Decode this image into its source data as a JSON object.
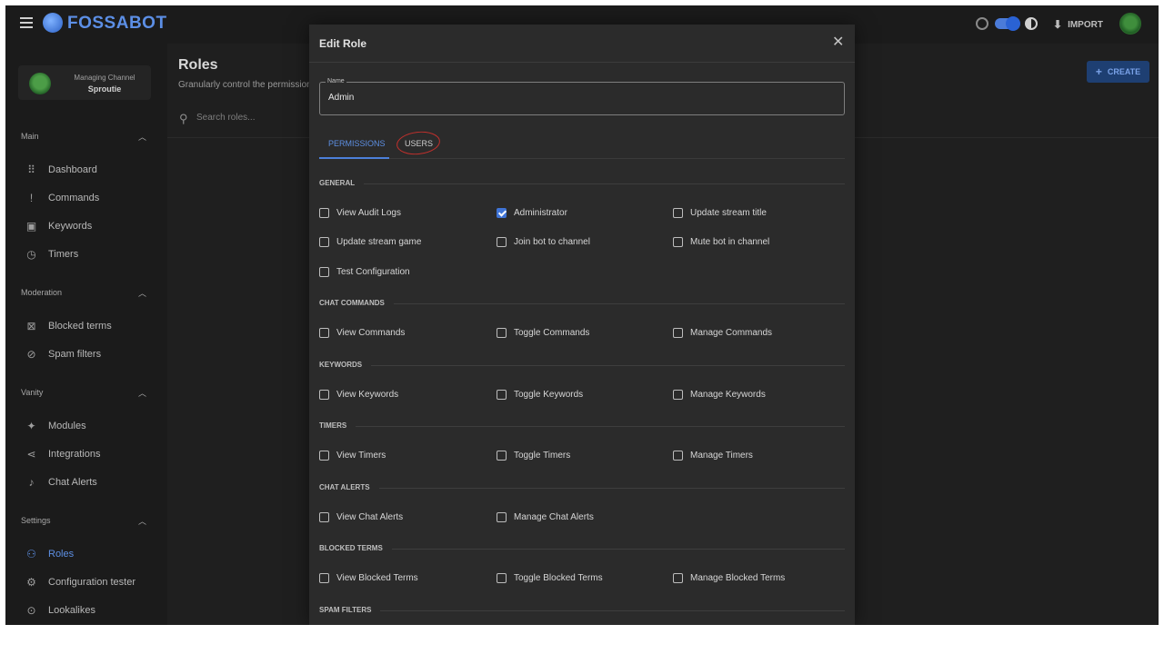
{
  "app": {
    "logo": "FOSSABOT"
  },
  "topbar": {
    "import_label": "IMPORT"
  },
  "sidebar": {
    "channel_label": "Managing Channel",
    "channel_name": "Sproutie",
    "sections": {
      "main": "Main",
      "moderation": "Moderation",
      "vanity": "Vanity",
      "settings": "Settings"
    },
    "items": {
      "dashboard": "Dashboard",
      "commands": "Commands",
      "keywords": "Keywords",
      "timers": "Timers",
      "blocked_terms": "Blocked terms",
      "spam_filters": "Spam filters",
      "modules": "Modules",
      "integrations": "Integrations",
      "chat_alerts": "Chat Alerts",
      "roles": "Roles",
      "configuration_tester": "Configuration tester",
      "lookalikes": "Lookalikes"
    }
  },
  "page": {
    "title": "Roles",
    "subtitle": "Granularly control the permissions",
    "search_placeholder": "Search roles...",
    "create_label": "CREATE"
  },
  "modal": {
    "title": "Edit Role",
    "name_label": "Name",
    "name_value": "Admin",
    "tabs": {
      "permissions": "PERMISSIONS",
      "users": "USERS"
    },
    "sections": {
      "general": "GENERAL",
      "chat_commands": "CHAT COMMANDS",
      "keywords": "KEYWORDS",
      "timers": "TIMERS",
      "chat_alerts": "CHAT ALERTS",
      "blocked_terms": "BLOCKED TERMS",
      "spam_filters": "SPAM FILTERS"
    },
    "permissions": {
      "view_audit_logs": "View Audit Logs",
      "administrator": "Administrator",
      "update_stream_title": "Update stream title",
      "update_stream_game": "Update stream game",
      "join_bot": "Join bot to channel",
      "mute_bot": "Mute bot in channel",
      "test_configuration": "Test Configuration",
      "view_commands": "View Commands",
      "toggle_commands": "Toggle Commands",
      "manage_commands": "Manage Commands",
      "view_keywords": "View Keywords",
      "toggle_keywords": "Toggle Keywords",
      "manage_keywords": "Manage Keywords",
      "view_timers": "View Timers",
      "toggle_timers": "Toggle Timers",
      "manage_timers": "Manage Timers",
      "view_chat_alerts": "View Chat Alerts",
      "manage_chat_alerts": "Manage Chat Alerts",
      "view_blocked_terms": "View Blocked Terms",
      "toggle_blocked_terms": "Toggle Blocked Terms",
      "manage_blocked_terms": "Manage Blocked Terms"
    },
    "checked": [
      "administrator"
    ]
  },
  "colors": {
    "accent": "#4c7fd9",
    "background": "#1f1f1f",
    "modal": "#2b2b2b",
    "annotation": "#c2302c"
  }
}
